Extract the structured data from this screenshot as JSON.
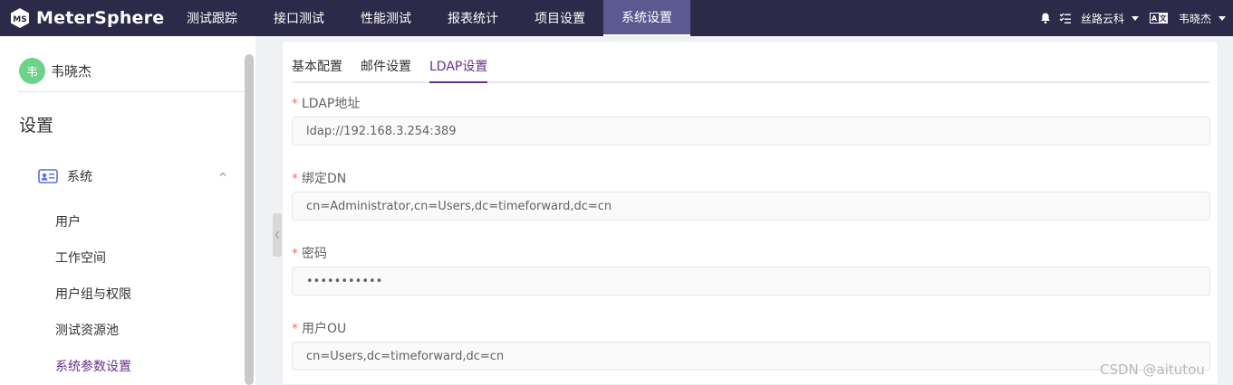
{
  "app": {
    "name": "MeterSphere"
  },
  "nav": [
    {
      "label": "测试跟踪",
      "active": false
    },
    {
      "label": "接口测试",
      "active": false
    },
    {
      "label": "性能测试",
      "active": false
    },
    {
      "label": "报表统计",
      "active": false
    },
    {
      "label": "项目设置",
      "active": false
    },
    {
      "label": "系统设置",
      "active": true
    }
  ],
  "header_right": {
    "workspace": "丝路云科",
    "lang_icon": "translate-icon",
    "user": "韦晓杰"
  },
  "sidebar": {
    "avatar_char": "韦",
    "user_name": "韦晓杰",
    "title": "设置",
    "system_label": "系统",
    "items": [
      {
        "label": "用户",
        "active": false
      },
      {
        "label": "工作空间",
        "active": false
      },
      {
        "label": "用户组与权限",
        "active": false
      },
      {
        "label": "测试资源池",
        "active": false
      },
      {
        "label": "系统参数设置",
        "active": true
      }
    ]
  },
  "tabs": [
    {
      "label": "基本配置",
      "active": false
    },
    {
      "label": "邮件设置",
      "active": false
    },
    {
      "label": "LDAP设置",
      "active": true
    }
  ],
  "form": {
    "required_mark": "*",
    "fields": [
      {
        "label": "LDAP地址",
        "value": "ldap://192.168.3.254:389"
      },
      {
        "label": "绑定DN",
        "value": "cn=Administrator,cn=Users,dc=timeforward,dc=cn"
      },
      {
        "label": "密码",
        "value": "•••••••••••"
      },
      {
        "label": "用户OU",
        "value": "cn=Users,dc=timeforward,dc=cn"
      }
    ]
  },
  "watermark": "CSDN @aitutou",
  "colors": {
    "topbar": "#2c2a48",
    "nav_active": "#5c5990",
    "accent": "#6a2f8a",
    "required": "#f56c6c"
  }
}
